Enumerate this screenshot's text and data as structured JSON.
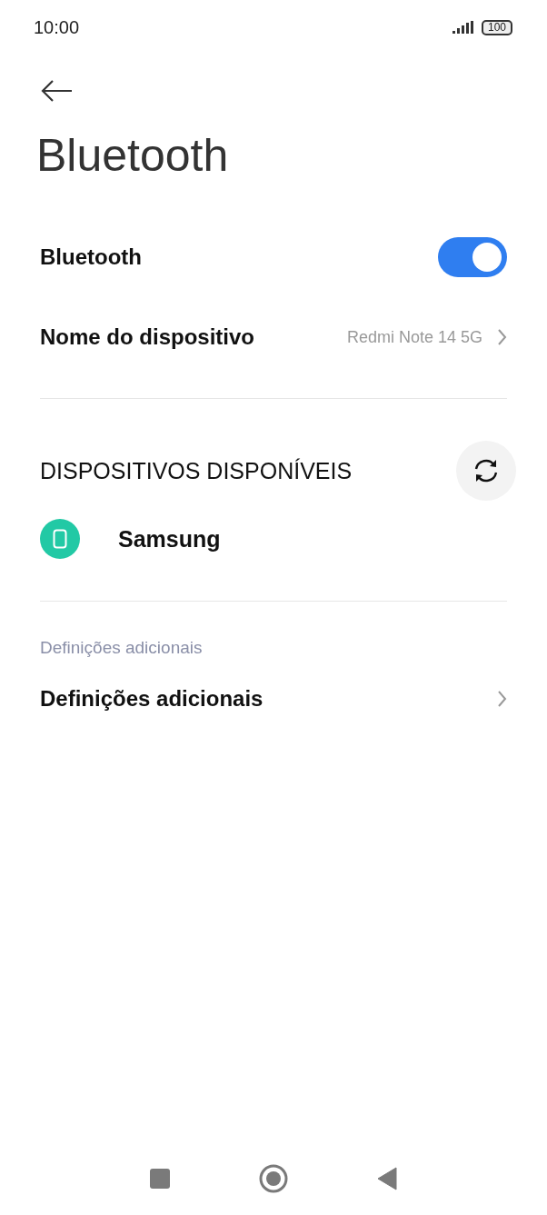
{
  "status_bar": {
    "time": "10:00",
    "battery": "100"
  },
  "title": "Bluetooth",
  "settings": [
    {
      "kind": "toggle",
      "label": "Bluetooth",
      "on": true
    },
    {
      "kind": "link",
      "label": "Nome do dispositivo",
      "value": "Redmi Note 14 5G"
    }
  ],
  "available": {
    "heading": "DISPOSITIVOS DISPONÍVEIS",
    "devices": [
      {
        "name": "Samsung"
      }
    ]
  },
  "additional": {
    "caption": "Definições adicionais",
    "items": [
      {
        "kind": "link",
        "label": "Definições adicionais"
      }
    ]
  }
}
